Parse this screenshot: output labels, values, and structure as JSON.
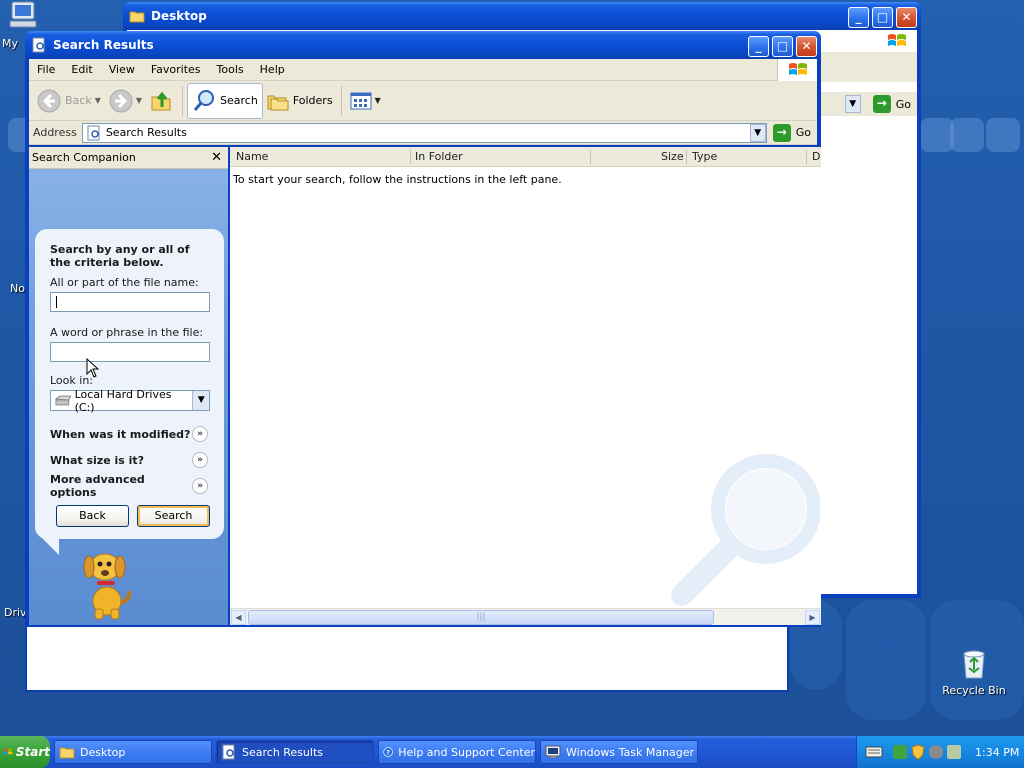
{
  "desktop": {
    "icons": {
      "my_computer": "My",
      "network": "No",
      "drives": "Driv",
      "recycle_bin": "Recycle Bin"
    }
  },
  "desktop_window": {
    "title": "Desktop",
    "go_label": "Go"
  },
  "search_window": {
    "title": "Search Results",
    "menu": [
      "File",
      "Edit",
      "View",
      "Favorites",
      "Tools",
      "Help"
    ],
    "toolbar": {
      "back": "Back",
      "search": "Search",
      "folders": "Folders"
    },
    "address": {
      "label": "Address",
      "value": "Search Results",
      "go": "Go"
    },
    "companion": {
      "header": "Search Companion",
      "title": "Search by any or all of the criteria below.",
      "filename_label": "All or part of the file name:",
      "filename_value": "",
      "phrase_label": "A word or phrase in the file:",
      "phrase_value": "",
      "lookin_label": "Look in:",
      "lookin_value": "Local Hard Drives (C:)",
      "modified": "When was it modified?",
      "size": "What size is it?",
      "advanced": "More advanced options",
      "back_button": "Back",
      "search_button": "Search"
    },
    "results": {
      "columns": [
        "Name",
        "In Folder",
        "Size",
        "Type",
        "D"
      ],
      "message": "To start your search, follow the instructions in the left pane."
    }
  },
  "taskbar": {
    "start": "Start",
    "tasks": [
      "Desktop",
      "Search Results",
      "Help and Support Center",
      "Windows Task Manager"
    ],
    "clock": "1:34 PM"
  },
  "colors": {
    "title_blue": "#0a46c6",
    "start_green": "#3aa53a",
    "tray_blue": "#1585e0"
  }
}
